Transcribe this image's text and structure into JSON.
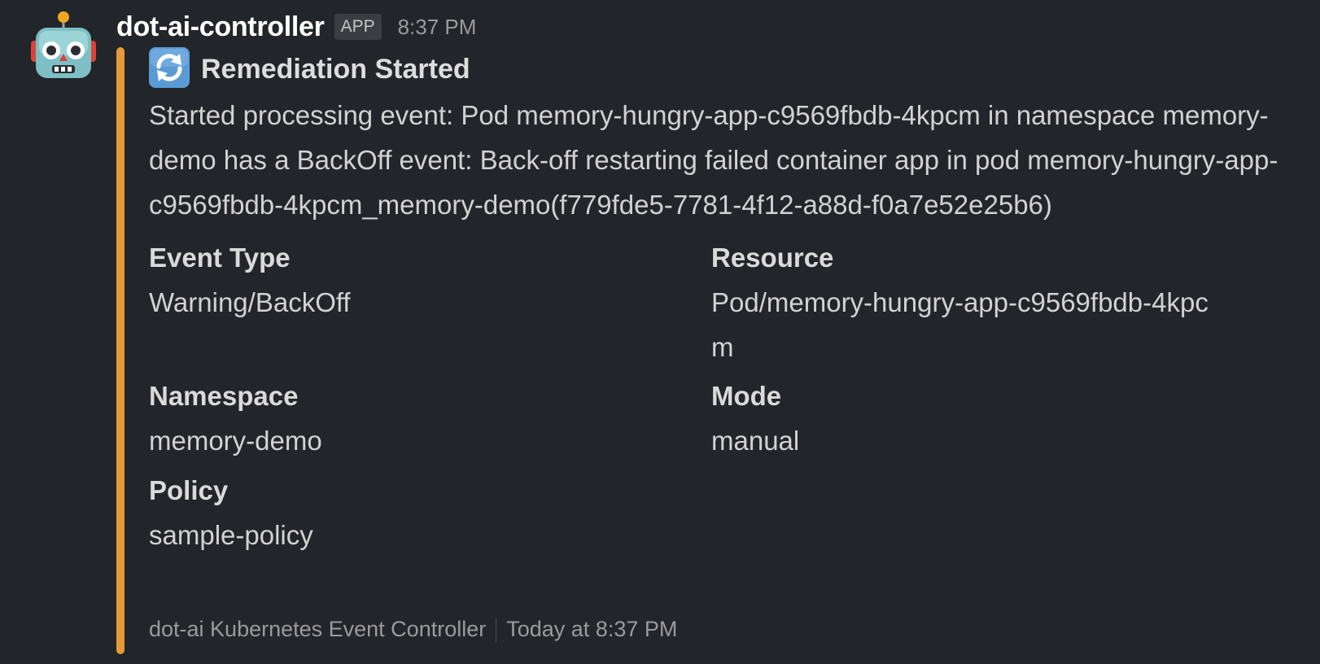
{
  "message": {
    "sender": "dot-ai-controller",
    "badge": "APP",
    "time": "8:37 PM",
    "avatar_icon": "robot-icon"
  },
  "attachment": {
    "accent_color": "#e59a3a",
    "icon": "refresh-icon",
    "title": "Remediation Started",
    "body": "Started processing event: Pod memory-hungry-app-c9569fbdb-4kpcm in namespace memory-demo has a BackOff event: Back-off restarting failed container app in pod memory-hungry-app-c9569fbdb-4kpcm_memory-demo(f779fde5-7781-4f12-a88d-f0a7e52e25b6)",
    "fields": [
      {
        "label": "Event Type",
        "value": "Warning/BackOff"
      },
      {
        "label": "Resource",
        "value": "Pod/memory-hungry-app-c9569fbdb-4kpcm"
      },
      {
        "label": "Namespace",
        "value": "memory-demo"
      },
      {
        "label": "Mode",
        "value": "manual"
      },
      {
        "label": "Policy",
        "value": "sample-policy"
      }
    ],
    "footer": {
      "source": "dot-ai Kubernetes Event Controller",
      "time": "Today at 8:37 PM"
    }
  }
}
